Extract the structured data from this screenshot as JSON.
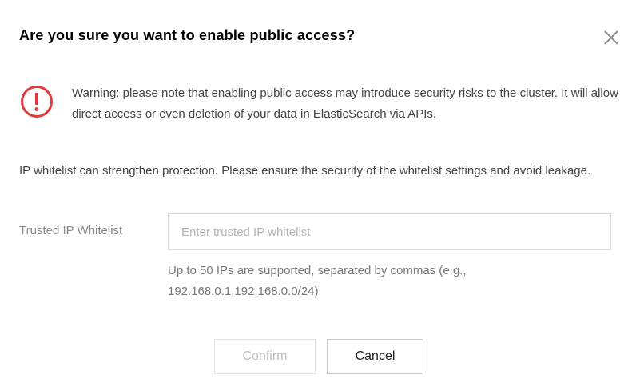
{
  "dialog": {
    "title": "Are you sure you want to enable public access?",
    "close_icon": "close-icon",
    "warning_icon": "exclamation-circle-icon",
    "warning_color": "#e03a3a",
    "warning_text": "Warning: please note that enabling public access may introduce security risks to the cluster. It will allow direct access or even deletion of your data in ElasticSearch via APIs.",
    "info_text": "IP whitelist can strengthen protection. Please ensure the security of the whitelist settings and avoid leakage.",
    "whitelist": {
      "label": "Trusted IP Whitelist",
      "placeholder": "Enter trusted IP whitelist",
      "value": "",
      "hint": "Up to 50 IPs are supported, separated by commas (e.g., 192.168.0.1,192.168.0.0/24)"
    },
    "buttons": {
      "confirm_label": "Confirm",
      "confirm_disabled": true,
      "cancel_label": "Cancel"
    }
  }
}
